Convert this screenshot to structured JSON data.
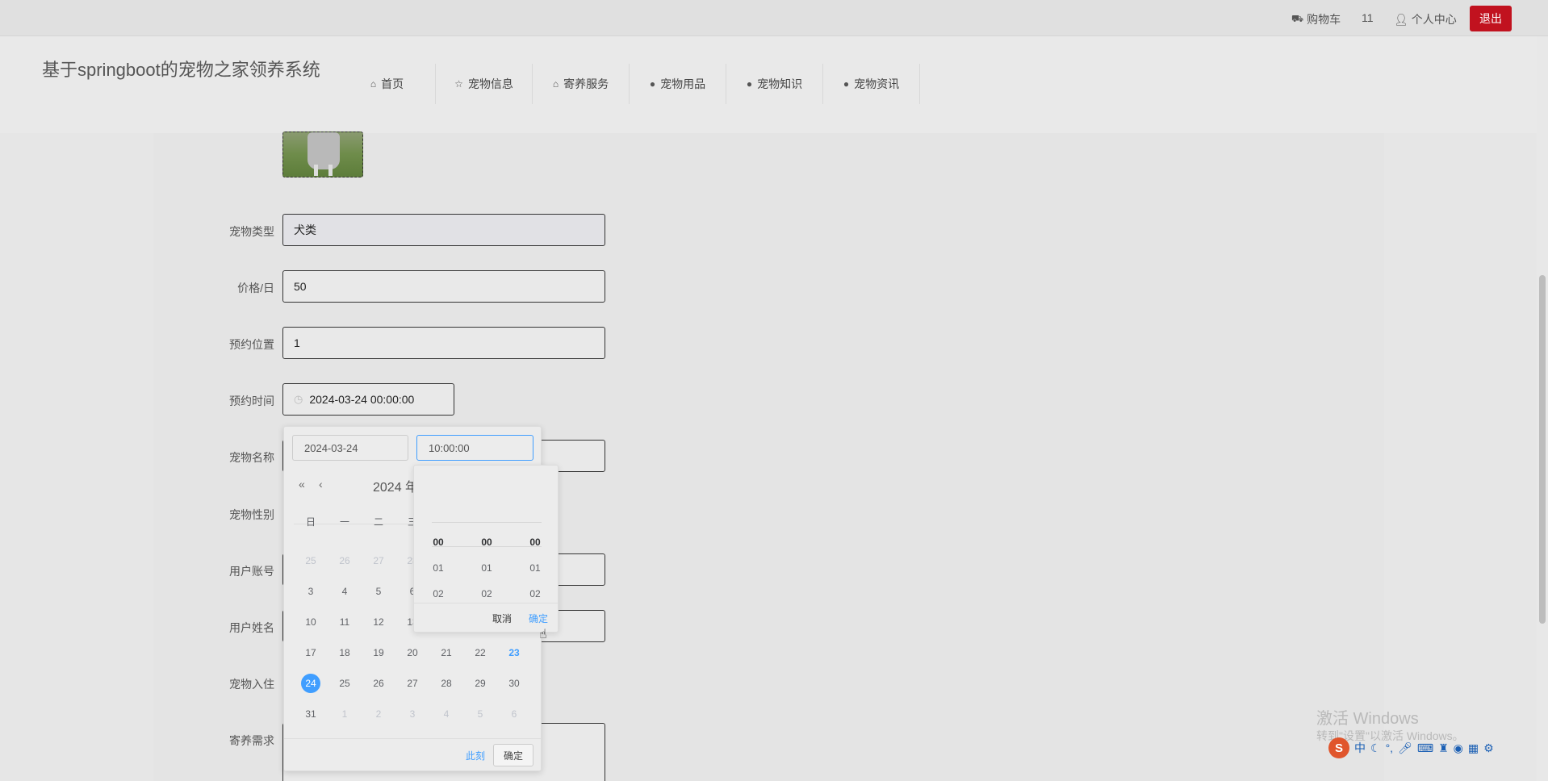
{
  "topbar": {
    "cart_label": "购物车",
    "count": "11",
    "profile_label": "个人中心",
    "logout_label": "退出"
  },
  "header": {
    "site_title": "基于springboot的宠物之家领养系统",
    "nav": [
      {
        "icon": "home-icon",
        "label": "首页"
      },
      {
        "icon": "star-icon",
        "label": "宠物信息"
      },
      {
        "icon": "bag-icon",
        "label": "寄养服务"
      },
      {
        "icon": "info-icon",
        "label": "宠物用品"
      },
      {
        "icon": "question-icon",
        "label": "宠物知识"
      },
      {
        "icon": "info-icon",
        "label": "宠物资讯"
      }
    ]
  },
  "form": {
    "pet_type_label": "宠物类型",
    "pet_type_value": "犬类",
    "price_label": "价格/日",
    "price_value": "50",
    "location_label": "预约位置",
    "location_value": "1",
    "time_label": "预约时间",
    "time_value": "2024-03-24 00:00:00",
    "pet_name_label": "宠物名称",
    "pet_gender_label": "宠物性别",
    "user_account_label": "用户账号",
    "user_name_label": "用户姓名",
    "checkin_label": "宠物入住",
    "needs_label": "寄养需求"
  },
  "datepicker": {
    "date_input": "2024-03-24",
    "time_input": "10:00:00",
    "year_label": "2024 年",
    "weekdays": [
      "日",
      "一",
      "二",
      "三"
    ],
    "rows": [
      [
        "25",
        "26",
        "27",
        "28"
      ],
      [
        "3",
        "4",
        "5",
        "6"
      ],
      [
        "10",
        "11",
        "12",
        "13"
      ],
      [
        "17",
        "18",
        "19",
        "20",
        "21",
        "22",
        "23"
      ],
      [
        "24",
        "25",
        "26",
        "27",
        "28",
        "29",
        "30"
      ],
      [
        "31",
        "1",
        "2",
        "3",
        "4",
        "5",
        "6"
      ]
    ],
    "now_label": "此刻",
    "confirm_label": "确定"
  },
  "timepicker": {
    "hours": [
      "00",
      "01",
      "02"
    ],
    "minutes": [
      "00",
      "01",
      "02"
    ],
    "seconds": [
      "00",
      "01",
      "02"
    ],
    "cancel_label": "取消",
    "confirm_label": "确定"
  },
  "watermark": {
    "line1": "激活 Windows",
    "line2": "转到\"设置\"以激活 Windows。"
  },
  "tray": {
    "ime_label": "中"
  },
  "colors": {
    "accent": "#409eff",
    "logout": "#c1121f"
  }
}
